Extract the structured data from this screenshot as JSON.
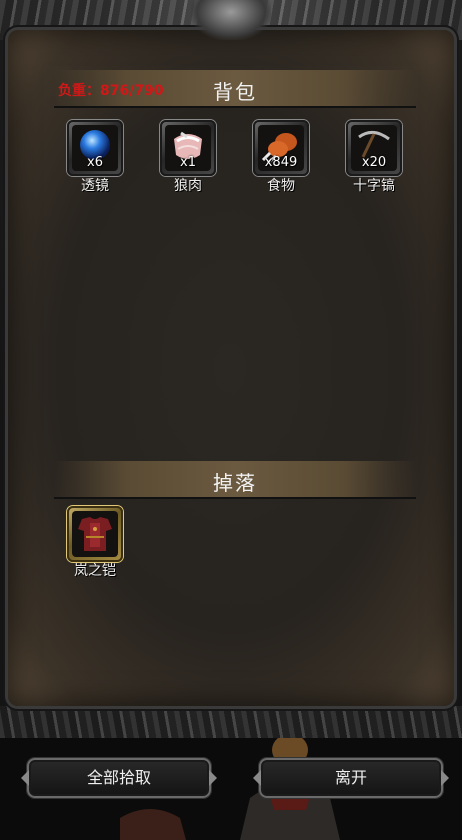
{
  "bag": {
    "title": "背包",
    "weight_label": "负重：876/790",
    "items": [
      {
        "name": "透镜",
        "qty": "x6",
        "icon": "blue-orb-icon"
      },
      {
        "name": "狼肉",
        "qty": "x1",
        "icon": "raw-meat-icon"
      },
      {
        "name": "食物",
        "qty": "x849",
        "icon": "roast-drumstick-icon"
      },
      {
        "name": "十字镐",
        "qty": "x20",
        "icon": "pickaxe-icon"
      }
    ]
  },
  "drops": {
    "title": "掉落",
    "items": [
      {
        "name": "岚之铠",
        "icon": "red-armor-icon"
      }
    ]
  },
  "buttons": {
    "pick_all": "全部拾取",
    "leave": "离开"
  },
  "colors": {
    "weight_text": "#d01818",
    "panel_bg": "#27231f",
    "header_bar": "#6b5a40"
  }
}
